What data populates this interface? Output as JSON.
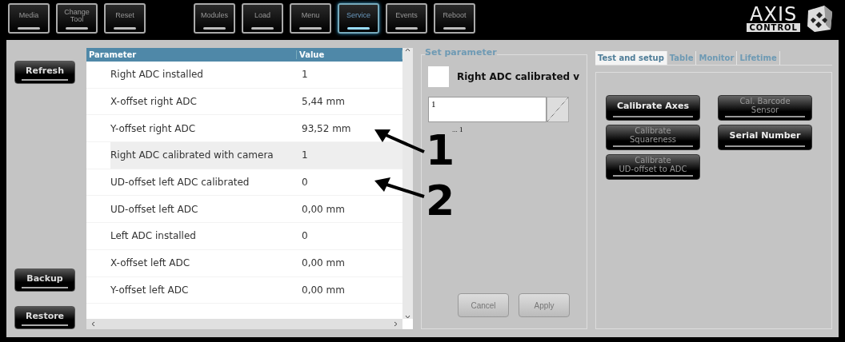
{
  "toolbar": {
    "groups": [
      [
        {
          "label": "Media",
          "selected": false
        },
        {
          "label": "Change Tool",
          "selected": false
        },
        {
          "label": "Reset",
          "selected": false
        }
      ],
      [
        {
          "label": "Modules",
          "selected": false
        },
        {
          "label": "Load",
          "selected": false
        },
        {
          "label": "Menu",
          "selected": false
        },
        {
          "label": "Service",
          "selected": true
        },
        {
          "label": "Events",
          "selected": false
        },
        {
          "label": "Reboot",
          "selected": false
        }
      ]
    ],
    "logo": {
      "top": "AXIS",
      "bottom": "CONTROL"
    }
  },
  "side_buttons": {
    "top": [
      "Refresh"
    ],
    "bottom": [
      "Backup",
      "Restore"
    ]
  },
  "table": {
    "columns": [
      "Parameter",
      "Value"
    ],
    "rows": [
      {
        "parameter": "Right ADC installed",
        "value": "1",
        "selected": false
      },
      {
        "parameter": "X-offset right ADC",
        "value": "5,44 mm",
        "selected": false
      },
      {
        "parameter": "Y-offset right ADC",
        "value": "93,52 mm",
        "selected": false
      },
      {
        "parameter": "Right ADC calibrated with camera",
        "value": "1",
        "selected": true
      },
      {
        "parameter": "UD-offset left ADC calibrated",
        "value": "0",
        "selected": false
      },
      {
        "parameter": "UD-offset left ADC",
        "value": "0,00 mm",
        "selected": false
      },
      {
        "parameter": "Left ADC installed",
        "value": "0",
        "selected": false
      },
      {
        "parameter": "X-offset left ADC",
        "value": "0,00 mm",
        "selected": false
      },
      {
        "parameter": "Y-offset left ADC",
        "value": "0,00 mm",
        "selected": false
      }
    ]
  },
  "set_parameter": {
    "legend": "Set parameter",
    "name": "Right ADC calibrated v",
    "value": "1",
    "range": "... 1",
    "buttons": [
      {
        "label": "Cancel",
        "disabled": true
      },
      {
        "label": "Apply",
        "disabled": true
      }
    ]
  },
  "tabs": [
    {
      "label": "Test and setup",
      "selected": true
    },
    {
      "label": "Table",
      "selected": false
    },
    {
      "label": "Monitor",
      "selected": false
    },
    {
      "label": "Lifetime",
      "selected": false
    }
  ],
  "actions": [
    {
      "lines": [
        "Calibrate Axes"
      ],
      "disabled": false
    },
    {
      "lines": [
        "Cal. Barcode",
        "Sensor"
      ],
      "disabled": true
    },
    {
      "lines": [
        "Calibrate",
        "Squareness"
      ],
      "disabled": true
    },
    {
      "lines": [
        "Serial Number"
      ],
      "disabled": false
    },
    {
      "lines": [
        "Calibrate",
        "UD-offset to ADC"
      ],
      "disabled": true
    }
  ],
  "callouts": [
    "1",
    "2"
  ]
}
